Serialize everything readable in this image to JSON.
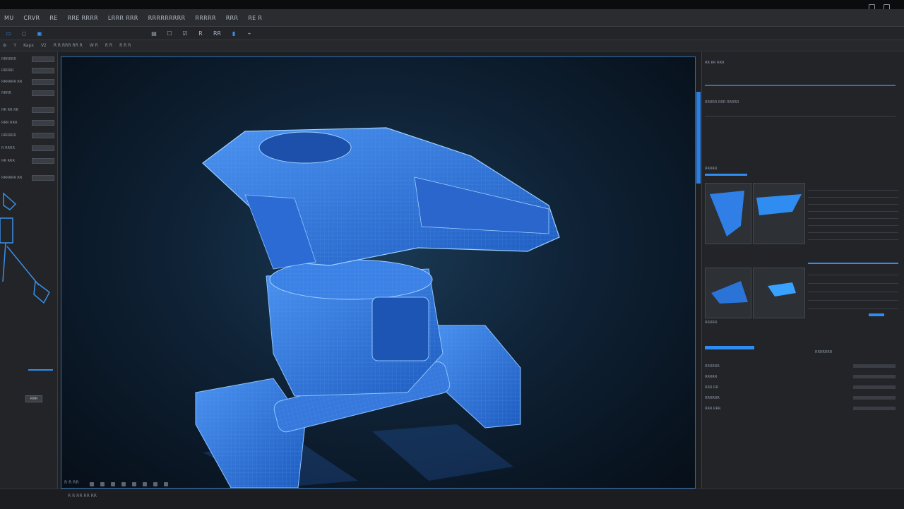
{
  "app": {
    "menu": [
      "MU",
      "CRVR",
      "RE",
      "RRE RRRR",
      "LRRR RRR",
      "RRRRRRRRR",
      "RRRRR",
      "RRR",
      "RE R"
    ]
  },
  "toolbar1": {
    "buttons": [
      "▭",
      "◌",
      "▣",
      "▤",
      "☐",
      "☑",
      "R",
      "RR",
      "▮",
      "⌁"
    ]
  },
  "toolbar2": {
    "items": [
      "Y",
      "Kapx",
      "V2",
      "R R RRR RR R",
      "W R",
      "R R",
      "R R R"
    ]
  },
  "left_panel": {
    "rows": [
      "RRRRRR",
      "RRRRR",
      "RRRRRR RR",
      "RRRR",
      "RR RR RR",
      "RRR RRR",
      "RRRRRR",
      "R RRRR",
      "RR RRR",
      "RRRRRR RR"
    ],
    "button": "RRR"
  },
  "viewport": {
    "label": "R R RR",
    "accent_color": "#2f7fe6"
  },
  "right_panel": {
    "header1": "RR RR RRR",
    "header2": "RRRRR RRR RRRRR",
    "header3": "RRRRR",
    "prop_label": "RRRRR",
    "props": [
      "RRRRRR",
      "RRRRR",
      "RRR RR",
      "RRRRRR",
      "RRR RRR"
    ],
    "footer": "RRRRRRR"
  },
  "status": {
    "text": "R R RR RR RR"
  }
}
